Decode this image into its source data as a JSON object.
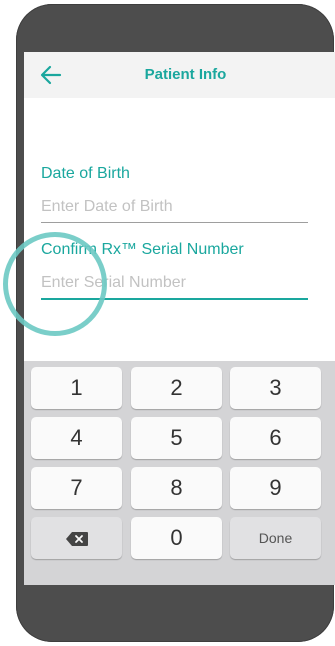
{
  "header": {
    "title": "Patient Info",
    "back_icon": "arrow-left-icon"
  },
  "form": {
    "dob": {
      "label": "Date of Birth",
      "placeholder": "Enter Date of Birth",
      "value": ""
    },
    "serial": {
      "label": "Confirm Rx™ Serial Number",
      "placeholder": "Enter Serial Number",
      "value": ""
    }
  },
  "keyboard": {
    "keys": [
      "1",
      "2",
      "3",
      "4",
      "5",
      "6",
      "7",
      "8",
      "9"
    ],
    "zero": "0",
    "done": "Done",
    "backspace_icon": "backspace-icon"
  },
  "colors": {
    "accent": "#1aa79e",
    "device": "#4d4d4d",
    "keyboard_bg": "#d4d4d6",
    "focus_ring": "#6cc9c3"
  }
}
